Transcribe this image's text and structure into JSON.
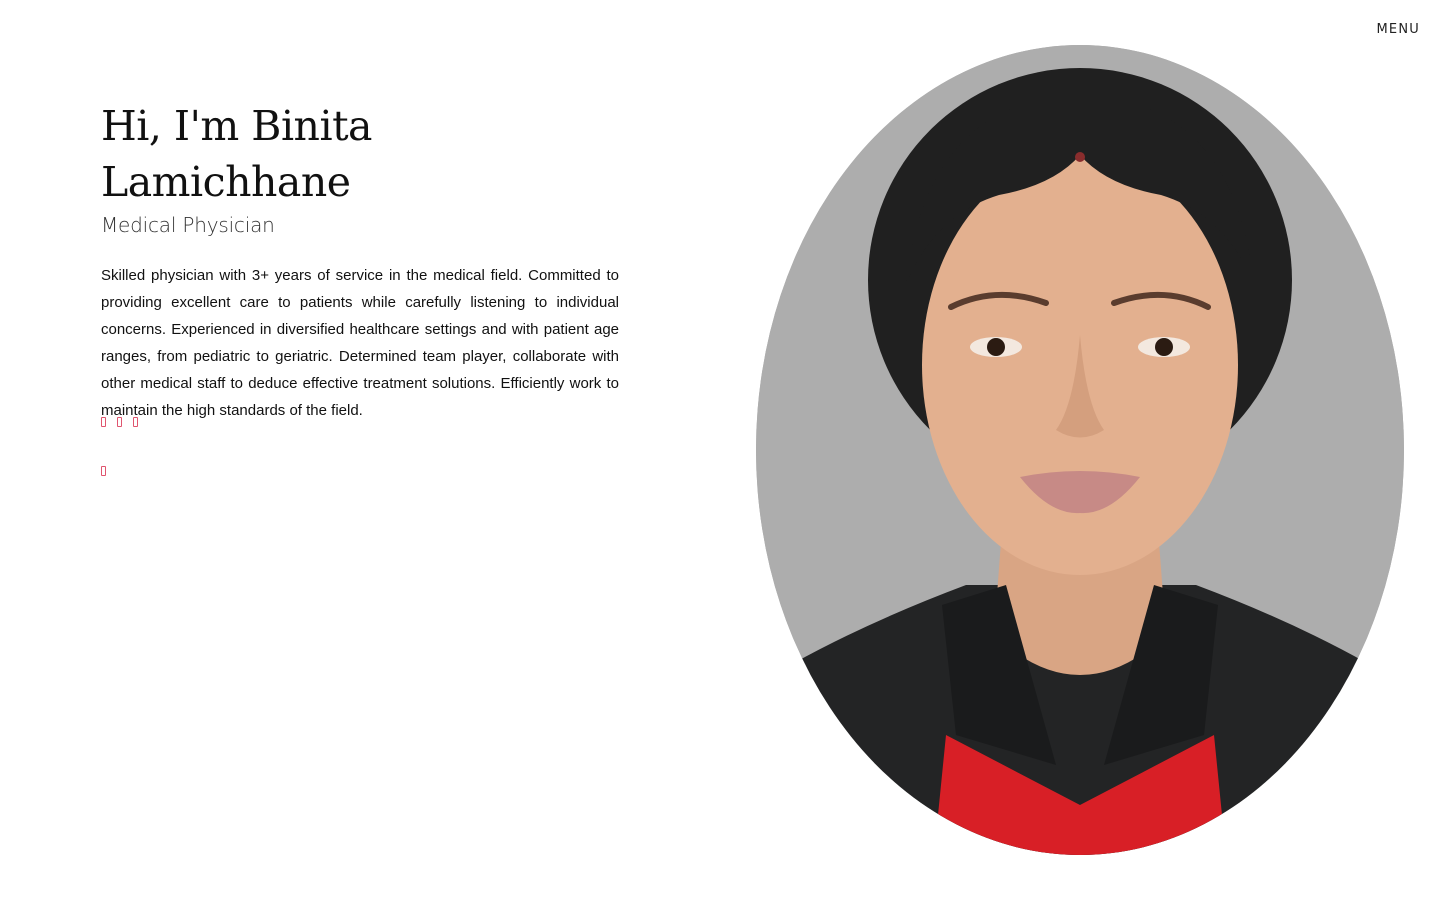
{
  "nav": {
    "menu_label": "MENU"
  },
  "hero": {
    "title": "Hi, I'm Binita Lamichhane",
    "subtitle": "Medical Physician",
    "bio": "Skilled physician with 3+ years of service in the medical field. Committed to providing excellent care to patients while carefully listening to individual concerns. Experienced in diversified healthcare settings and with patient age ranges, from pediatric to geriatric. Determined team player, collaborate with other medical staff to deduce effective treatment solutions. Efficiently work to maintain the high standards of the field."
  },
  "social": {
    "row1_icons": [
      "social-icon",
      "social-icon",
      "social-icon"
    ],
    "row2_icons": [
      "social-icon"
    ],
    "icon_color": "#e0556f"
  },
  "portrait": {
    "background_color": "#adadad"
  }
}
